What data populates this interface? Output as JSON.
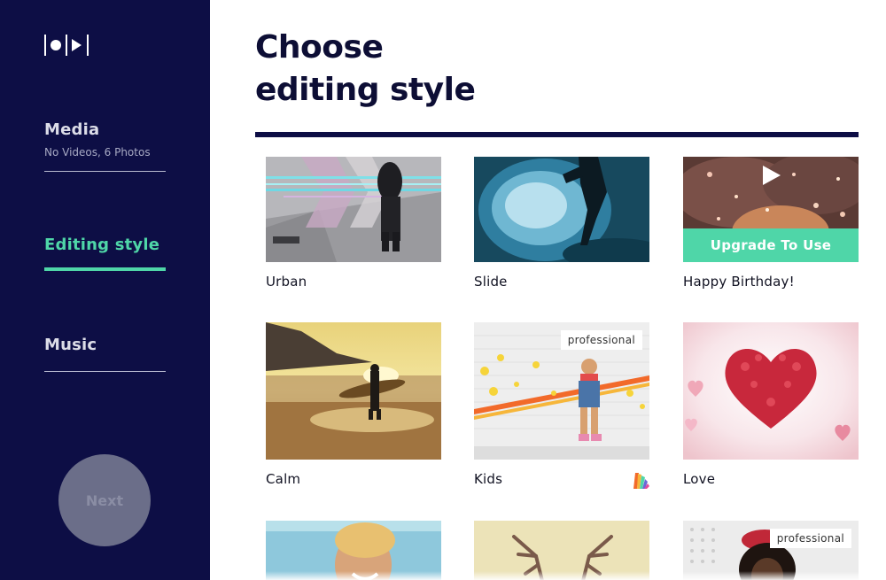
{
  "sidebar": {
    "logo_icon": "record-play-logo-icon",
    "items": [
      {
        "label": "Media",
        "sub": "No Videos, 6 Photos",
        "active": false
      },
      {
        "label": "Editing style",
        "sub": "",
        "active": true
      },
      {
        "label": "Music",
        "sub": "",
        "active": false
      }
    ],
    "next_label": "Next"
  },
  "main": {
    "heading_line1": "Choose",
    "heading_line2": "editing style"
  },
  "styles": [
    {
      "label": "Urban",
      "badge": "",
      "upgrade": ""
    },
    {
      "label": "Slide",
      "badge": "",
      "upgrade": ""
    },
    {
      "label": "Happy Birthday!",
      "badge": "",
      "upgrade": "Upgrade To Use"
    },
    {
      "label": "Calm",
      "badge": "",
      "upgrade": ""
    },
    {
      "label": "Kids",
      "badge": "professional",
      "upgrade": ""
    },
    {
      "label": "Love",
      "badge": "",
      "upgrade": ""
    },
    {
      "label": "",
      "badge": "",
      "upgrade": ""
    },
    {
      "label": "",
      "badge": "",
      "upgrade": ""
    },
    {
      "label": "",
      "badge": "professional",
      "upgrade": ""
    }
  ],
  "colors": {
    "sidebar_bg": "#0d0e45",
    "accent": "#4fd6a8",
    "heading": "#0d0e35"
  }
}
